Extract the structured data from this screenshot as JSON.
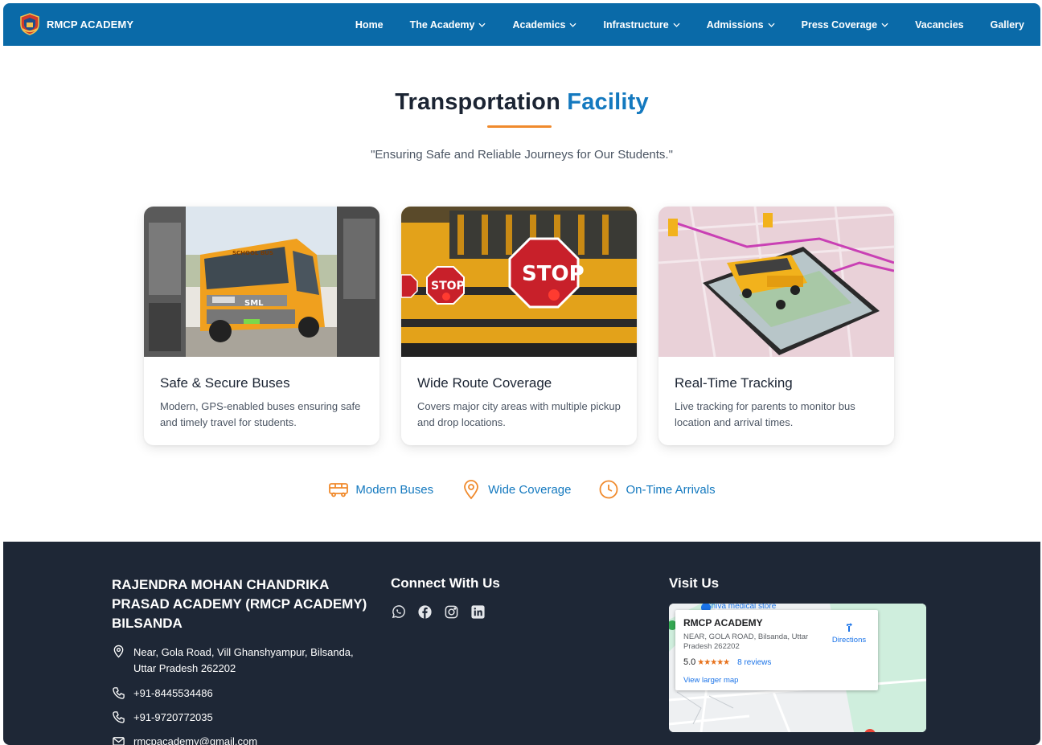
{
  "brand": {
    "name": "RMCP ACADEMY"
  },
  "nav": [
    {
      "label": "Home",
      "dropdown": false
    },
    {
      "label": "The Academy",
      "dropdown": true
    },
    {
      "label": "Academics",
      "dropdown": true
    },
    {
      "label": "Infrastructure",
      "dropdown": true
    },
    {
      "label": "Admissions",
      "dropdown": true
    },
    {
      "label": "Press Coverage",
      "dropdown": true
    },
    {
      "label": "Vacancies",
      "dropdown": false
    },
    {
      "label": "Gallery",
      "dropdown": false
    }
  ],
  "hero": {
    "title_main": "Transportation",
    "title_accent": "Facility",
    "subtitle": "\"Ensuring Safe and Reliable Journeys for Our Students.\""
  },
  "cards": [
    {
      "title": "Safe & Secure Buses",
      "desc": "Modern, GPS-enabled buses ensuring safe and timely travel for students.",
      "image": "orange-school-bus-photo"
    },
    {
      "title": "Wide Route Coverage",
      "desc": "Covers major city areas with multiple pickup and drop locations.",
      "image": "school-bus-stop-sign-photo"
    },
    {
      "title": "Real-Time Tracking",
      "desc": "Live tracking for parents to monitor bus location and arrival times.",
      "image": "bus-on-phone-map-illustration"
    }
  ],
  "features": [
    {
      "label": "Modern Buses",
      "icon": "bus-icon"
    },
    {
      "label": "Wide Coverage",
      "icon": "map-pin-icon"
    },
    {
      "label": "On-Time Arrivals",
      "icon": "clock-icon"
    }
  ],
  "footer": {
    "org_name": "RAJENDRA MOHAN CHANDRIKA PRASAD ACADEMY (RMCP ACADEMY) BILSANDA",
    "address": "Near, Gola Road, Vill Ghanshyampur, Bilsanda, Uttar Pradesh 262202",
    "phone1": "+91-8445534486",
    "phone2": "+91-9720772035",
    "email": "rmcpacademy@gmail.com",
    "connect_heading": "Connect With Us",
    "socials": [
      "whatsapp-icon",
      "facebook-icon",
      "instagram-icon",
      "linkedin-icon"
    ],
    "visit_heading": "Visit Us",
    "map": {
      "nearby_label": "Shiva medical store",
      "place_name": "RMCP ACADEMY",
      "place_address": "NEAR, GOLA ROAD, Bilsanda, Uttar Pradesh 262202",
      "rating": "5.0",
      "stars": "★★★★★",
      "reviews": "8 reviews",
      "view_larger": "View larger map",
      "directions": "Directions"
    }
  },
  "colors": {
    "nav_bg": "#0a6aa8",
    "accent_blue": "#1479bf",
    "accent_orange": "#f08a2c",
    "footer_bg": "#1e2736"
  }
}
